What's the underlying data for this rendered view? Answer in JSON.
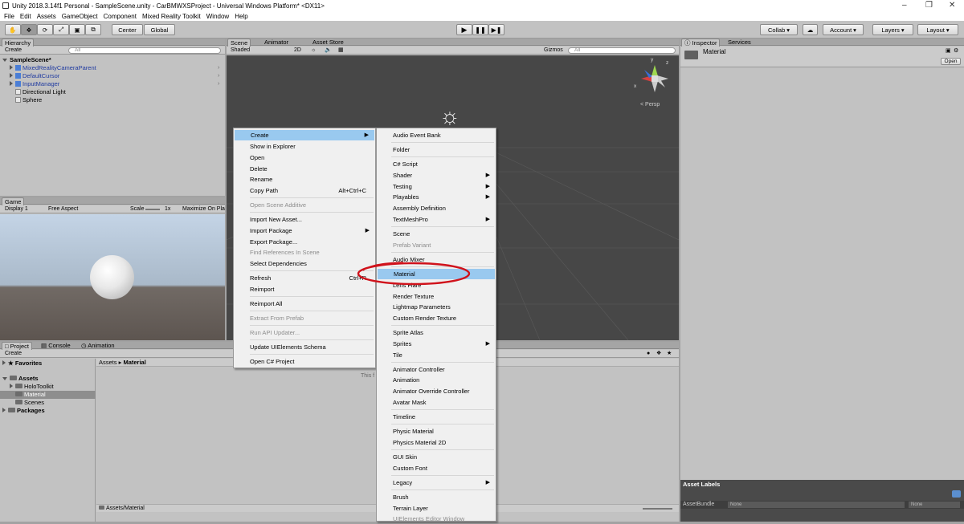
{
  "window": {
    "title": "Unity 2018.3.14f1 Personal - SampleScene.unity - CarBMWXSProject - Universal Windows Platform* <DX11>"
  },
  "menubar": [
    "File",
    "Edit",
    "Assets",
    "GameObject",
    "Component",
    "Mixed Reality Toolkit",
    "Window",
    "Help"
  ],
  "toolbar": {
    "center": "Center",
    "global": "Global",
    "collab": "Collab",
    "account": "Account",
    "layers": "Layers",
    "layout": "Layout"
  },
  "hierarchy": {
    "tab": "Hierarchy",
    "create": "Create",
    "search": "All",
    "scene": "SampleScene*",
    "items": [
      "MixedRealityCameraParent",
      "DefaultCursor",
      "InputManager",
      "Directional Light",
      "Sphere"
    ]
  },
  "scene": {
    "tabs": [
      "Scene",
      "Animator",
      "Asset Store"
    ],
    "shading": "Shaded",
    "mode2d": "2D",
    "gizmos": "Gizmos",
    "search": "All",
    "persp": "< Persp",
    "axes": {
      "x": "x",
      "y": "y",
      "z": "z"
    }
  },
  "game": {
    "tab": "Game",
    "display": "Display 1",
    "aspect": "Free Aspect",
    "scale": "Scale",
    "scale_value": "1x",
    "maximize": "Maximize On Pla"
  },
  "project": {
    "tabs": [
      "Project",
      "Console",
      "Animation"
    ],
    "create": "Create",
    "favorites": "Favorites",
    "assets": "Assets",
    "folders": [
      "HoloToolkit",
      "Material",
      "Scenes"
    ],
    "packages": "Packages",
    "breadcrumb_root": "Assets",
    "breadcrumb_current": "Material",
    "footer_path": "Assets/Material",
    "empty_text": "This f"
  },
  "inspector": {
    "tabs": [
      "Inspector",
      "Services"
    ],
    "title": "Material",
    "open": "Open",
    "asset_labels": "Asset Labels",
    "asset_bundle": "AssetBundle",
    "none1": "None",
    "none2": "None"
  },
  "context_menu": {
    "items": [
      "Create",
      "Show in Explorer",
      "Open",
      "Delete",
      "Rename",
      "Copy Path",
      "Open Scene Additive",
      "Import New Asset...",
      "Import Package",
      "Export Package...",
      "Find References In Scene",
      "Select Dependencies",
      "Refresh",
      "Reimport",
      "Reimport All",
      "Extract From Prefab",
      "Run API Updater...",
      "Update UIElements Schema",
      "Open C# Project"
    ],
    "shortcuts": {
      "copy_path": "Alt+Ctrl+C",
      "refresh": "Ctrl+R"
    }
  },
  "create_submenu": {
    "items": [
      "Audio Event Bank",
      "Folder",
      "C# Script",
      "Shader",
      "Testing",
      "Playables",
      "Assembly Definition",
      "TextMeshPro",
      "Scene",
      "Prefab Variant",
      "Audio Mixer",
      "Material",
      "Lens Flare",
      "Render Texture",
      "Lightmap Parameters",
      "Custom Render Texture",
      "Sprite Atlas",
      "Sprites",
      "Tile",
      "Animator Controller",
      "Animation",
      "Animator Override Controller",
      "Avatar Mask",
      "Timeline",
      "Physic Material",
      "Physics Material 2D",
      "GUI Skin",
      "Custom Font",
      "Legacy",
      "Brush",
      "Terrain Layer",
      "UIElements Editor Window"
    ]
  },
  "colors": {
    "highlight": "#99c9ef",
    "annotation": "#d0121b",
    "selection": "#8e8e8e",
    "scene_bg": "#474747"
  }
}
